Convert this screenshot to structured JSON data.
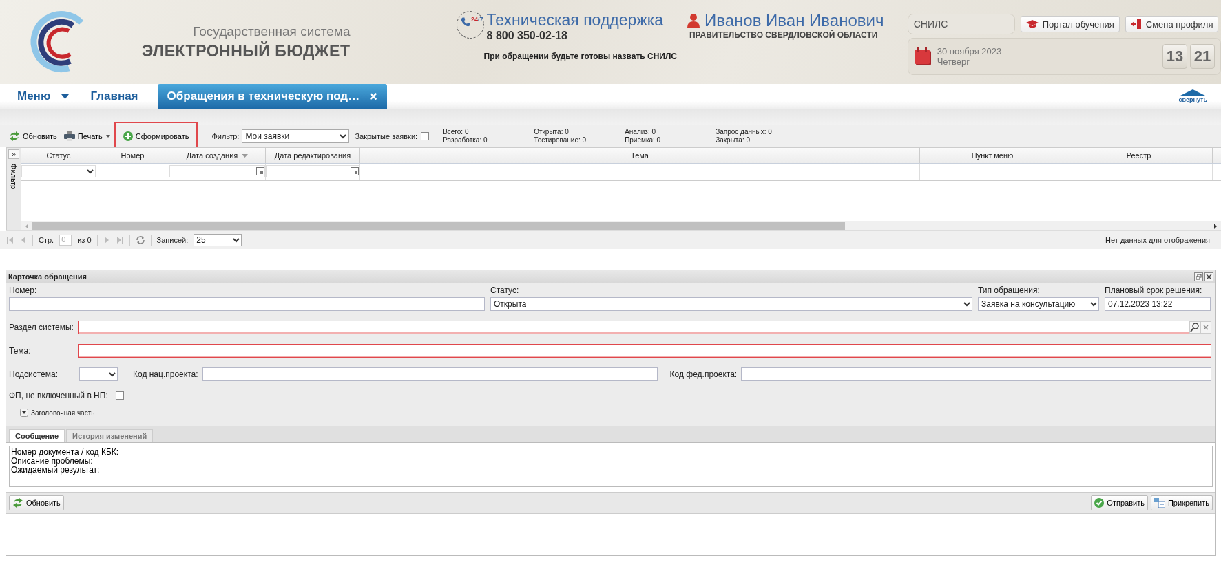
{
  "header": {
    "logo": {
      "line1": "Государственная система",
      "line2": "ЭЛЕКТРОННЫЙ БЮДЖЕТ"
    },
    "support": {
      "badge_hours": "24",
      "badge_days": "/7",
      "title": "Техническая поддержка",
      "phone": "8 800 350-02-18",
      "note": "При обращении будьте готовы назвать СНИЛС"
    },
    "user": {
      "name": "Иванов Иван Иванович",
      "organization": "ПРАВИТЕЛЬСТВО СВЕРДЛОВСКОЙ ОБЛАСТИ"
    },
    "snils_field": {
      "placeholder": "СНИЛС"
    },
    "buttons": [
      {
        "label": "Портал обучения",
        "kind": "learning"
      },
      {
        "label": "Смена профиля",
        "kind": "switch"
      }
    ],
    "date": {
      "date": "30 ноября 2023",
      "weekday": "Четверг"
    },
    "clock": {
      "hours": "13",
      "minutes": "21"
    }
  },
  "nav": {
    "menu": "Меню",
    "home": "Главная",
    "tabs": [
      {
        "label": "Обращения в техническую под…",
        "selected": true,
        "close": "×"
      }
    ],
    "collapse": "свернуть"
  },
  "toolbar": {
    "buttons": [
      {
        "label": "Обновить",
        "kind": "refresh",
        "highlighted": false
      },
      {
        "label": "Печать",
        "kind": "print",
        "highlighted": false
      },
      {
        "label": "Сформировать",
        "kind": "create",
        "highlighted": true
      }
    ],
    "filter": {
      "label": "Фильтр:",
      "value": "Мои заявки"
    },
    "closed": {
      "label": "Закрытые заявки:",
      "checked": false
    },
    "counters": [
      [
        "Всего: 0",
        "Разработка: 0"
      ],
      [
        "Открыта: 0",
        "Тестирование: 0"
      ],
      [
        "Анализ: 0",
        "Приемка: 0"
      ],
      [
        "Запрос данных: 0",
        "Закрыта: 0"
      ]
    ]
  },
  "grid": {
    "expand": "»",
    "side_label": "Фильтр",
    "columns": [
      {
        "label": "Статус",
        "kind": "select",
        "sorted": false
      },
      {
        "label": "Номер",
        "kind": "plain",
        "sorted": false
      },
      {
        "label": "Дата создания",
        "kind": "date",
        "sorted": true
      },
      {
        "label": "Дата редактирования",
        "kind": "date",
        "sorted": false
      },
      {
        "label": "Тема",
        "kind": "plain",
        "sorted": false
      },
      {
        "label": "Пункт меню",
        "kind": "plain",
        "sorted": false
      },
      {
        "label": "Реестр",
        "kind": "plain",
        "sorted": false
      }
    ]
  },
  "pager": {
    "page_label": "Стр.",
    "page": "0",
    "of": "из 0",
    "records_label": "Записей:",
    "records": "25",
    "status": "Нет данных для отображения"
  },
  "card": {
    "title": "Карточка обращения",
    "number": {
      "label": "Номер:"
    },
    "status": {
      "label": "Статус:",
      "value": "Открыта"
    },
    "type": {
      "label": "Тип обращения:",
      "value": "Заявка на консультацию"
    },
    "deadline": {
      "label": "Плановый срок решения:",
      "value": "07.12.2023 13:22"
    },
    "section": {
      "label": "Раздел системы:",
      "invalid": true
    },
    "topic": {
      "label": "Тема:",
      "invalid": true
    },
    "subsystem": {
      "label": "Подсистема:"
    },
    "nat_project": {
      "label": "Код нац.проекта:"
    },
    "fed_project": {
      "label": "Код фед.проекта:"
    },
    "fp_excluded": {
      "label": "ФП, не включенный в НП:",
      "checked": false
    },
    "header_part": {
      "label": "Заголовочная часть",
      "expanded": false
    },
    "tabs": [
      {
        "label": "Сообщение",
        "selected": true
      },
      {
        "label": "История изменений",
        "selected": false
      }
    ],
    "message": "Номер документа / код КБК:\nОписание проблемы:\nОжидаемый результат:",
    "refresh": "Обновить",
    "actions": [
      {
        "label": "Отправить",
        "kind": "send"
      },
      {
        "label": "Прикрепить",
        "kind": "attach"
      }
    ]
  }
}
